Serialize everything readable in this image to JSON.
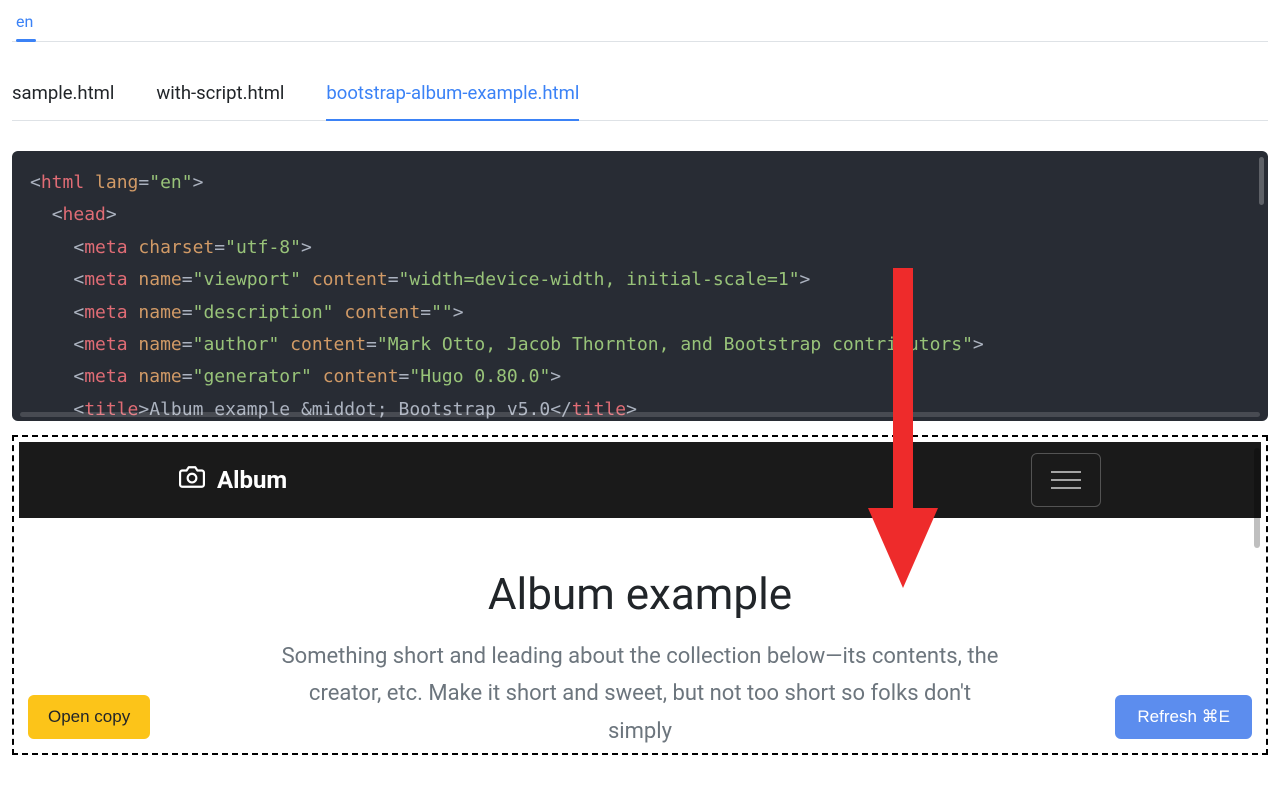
{
  "lang_tabs": {
    "active": "en"
  },
  "file_tabs": {
    "items": [
      {
        "label": "sample.html",
        "active": false
      },
      {
        "label": "with-script.html",
        "active": false
      },
      {
        "label": "bootstrap-album-example.html",
        "active": true
      }
    ]
  },
  "code": {
    "l1": {
      "p1": "<",
      "t": "html",
      "sp": " ",
      "a": "lang",
      "eq": "=",
      "q1": "\"",
      "v": "en",
      "q2": "\"",
      "p2": ">"
    },
    "l2": {
      "i": "  ",
      "p1": "<",
      "t": "head",
      "p2": ">"
    },
    "l3": {
      "i": "    ",
      "p1": "<",
      "t": "meta",
      "sp": " ",
      "a": "charset",
      "eq": "=",
      "q1": "\"",
      "v": "utf-8",
      "q2": "\"",
      "p2": ">"
    },
    "l4": {
      "i": "    ",
      "p1": "<",
      "t": "meta",
      "sp": " ",
      "a1": "name",
      "eq1": "=",
      "q1": "\"",
      "v1": "viewport",
      "q2": "\"",
      "sp2": " ",
      "a2": "content",
      "eq2": "=",
      "q3": "\"",
      "v2": "width=device-width, initial-scale=1",
      "q4": "\"",
      "p2": ">"
    },
    "l5": {
      "i": "    ",
      "p1": "<",
      "t": "meta",
      "sp": " ",
      "a1": "name",
      "eq1": "=",
      "q1": "\"",
      "v1": "description",
      "q2": "\"",
      "sp2": " ",
      "a2": "content",
      "eq2": "=",
      "q3": "\"",
      "v2": "",
      "q4": "\"",
      "p2": ">"
    },
    "l6": {
      "i": "    ",
      "p1": "<",
      "t": "meta",
      "sp": " ",
      "a1": "name",
      "eq1": "=",
      "q1": "\"",
      "v1": "author",
      "q2": "\"",
      "sp2": " ",
      "a2": "content",
      "eq2": "=",
      "q3": "\"",
      "v2": "Mark Otto, Jacob Thornton, and Bootstrap contributors",
      "q4": "\"",
      "p2": ">"
    },
    "l7": {
      "i": "    ",
      "p1": "<",
      "t": "meta",
      "sp": " ",
      "a1": "name",
      "eq1": "=",
      "q1": "\"",
      "v1": "generator",
      "q2": "\"",
      "sp2": " ",
      "a2": "content",
      "eq2": "=",
      "q3": "\"",
      "v2": "Hugo 0.80.0",
      "q4": "\"",
      "p2": ">"
    },
    "l8": {
      "i": "    ",
      "p1": "<",
      "t": "title",
      "p2": ">",
      "txt": "Album example &middot; Bootstrap v5.0",
      "p3": "</",
      "t2": "title",
      "p4": ">"
    }
  },
  "preview": {
    "navbar_brand": "Album",
    "hero_title": "Album example",
    "hero_lead": "Something short and leading about the collection below—its contents, the creator, etc. Make it short and sweet, but not too short so folks don't simply"
  },
  "buttons": {
    "open_copy": "Open copy",
    "refresh": "Refresh ⌘E"
  }
}
